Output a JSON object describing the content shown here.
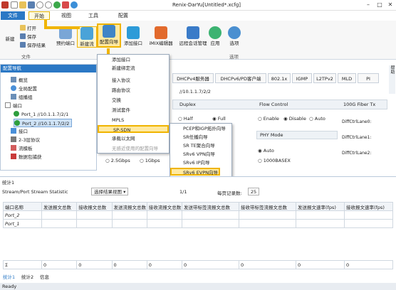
{
  "title": "Renix-DarYu[Untitled*.xcfg]",
  "menus": {
    "file": "文件",
    "start": "开始",
    "view": "视图",
    "tools": "工具",
    "config": "配置"
  },
  "ribbon": {
    "new": "新建",
    "open": "打开",
    "save": "保存",
    "save_result": "保存结果",
    "file_group": "文件",
    "reserve_port": "预约端口",
    "new_stream": "新建流",
    "config_wizard": "配置向导",
    "add_interface": "添加接口",
    "imix": "iMIX编辑器",
    "remote": "远程会话管理",
    "apply": "应用",
    "options": "选项",
    "options_group": "选项"
  },
  "nav": {
    "header": "配置导航",
    "items": [
      "概览",
      "全局配置",
      "组播组",
      "端口",
      "Port_1 //10.1.1.7/2/1",
      "Port_2 //10.1.1.7/2/2",
      "接口",
      "2-3层协议",
      "流模板",
      "数据包捕获"
    ]
  },
  "content": {
    "tabs": [
      "DHCPv4服务器",
      "DHCPv6/PD客户端",
      "802.1x",
      "IGMP",
      "L2TPv2",
      "MLD",
      "PI"
    ],
    "location": "//10.1.1.7/2/2",
    "duplex": "Duplex",
    "half": "Half",
    "full": "Full",
    "flow_control": "Flow Control",
    "enable": "Enable",
    "disable": "Disable",
    "auto": "Auto",
    "phy_mode": "PHY Mode",
    "auto2": "Auto",
    "basex": "1000BASEX",
    "fiber": "100G Fiber Tx",
    "lane0": "DiffCtrlLane0:",
    "lane1": "DiffCtrlLane1:",
    "lane2": "DiffCtrlLane2:",
    "speed1": "2.5Gbps",
    "speed2": "1Gbps",
    "help_tab": "帮助"
  },
  "menu1": {
    "items": [
      "添加接口",
      "新建绑定流",
      "接入协议",
      "路由协议",
      "交换",
      "测试套件",
      "MPLS",
      "SP-SDN",
      "承载以太网",
      "无感近使用的配置向导"
    ]
  },
  "menu2": {
    "items": [
      "PCEP和IGP拓扑向导",
      "SR任播向导",
      "SR TE聚合向导",
      "SRv6 VPN向导",
      "SRv6 IP向导",
      "SRv6 EVPN向导"
    ]
  },
  "stats": {
    "header": "统计1",
    "toolbar_label": "Stream/Port Stream Statistic",
    "select_view": "选择结果视图",
    "page": "1/1",
    "per_page_label": "每页记录数:",
    "per_page": "25",
    "columns": [
      "端口名称",
      "发送报文总数",
      "接收报文总数",
      "发送流报文总数",
      "接收流报文总数",
      "发送带标签流报文总数",
      "接收带标签流报文总数",
      "发送报文速率(fps)",
      "接收报文速率(fps)"
    ],
    "rows": [
      [
        "Port_2",
        "",
        "",
        "",
        "",
        "",
        "",
        "",
        ""
      ],
      [
        "Port_1",
        "",
        "",
        "",
        "",
        "",
        "",
        "",
        ""
      ]
    ],
    "totals": [
      "",
      "0",
      "0",
      "0",
      "0",
      "0",
      "0",
      "0",
      "0"
    ],
    "bottom_tabs": [
      "统计1",
      "统计2",
      "信息"
    ]
  },
  "status": "Ready"
}
